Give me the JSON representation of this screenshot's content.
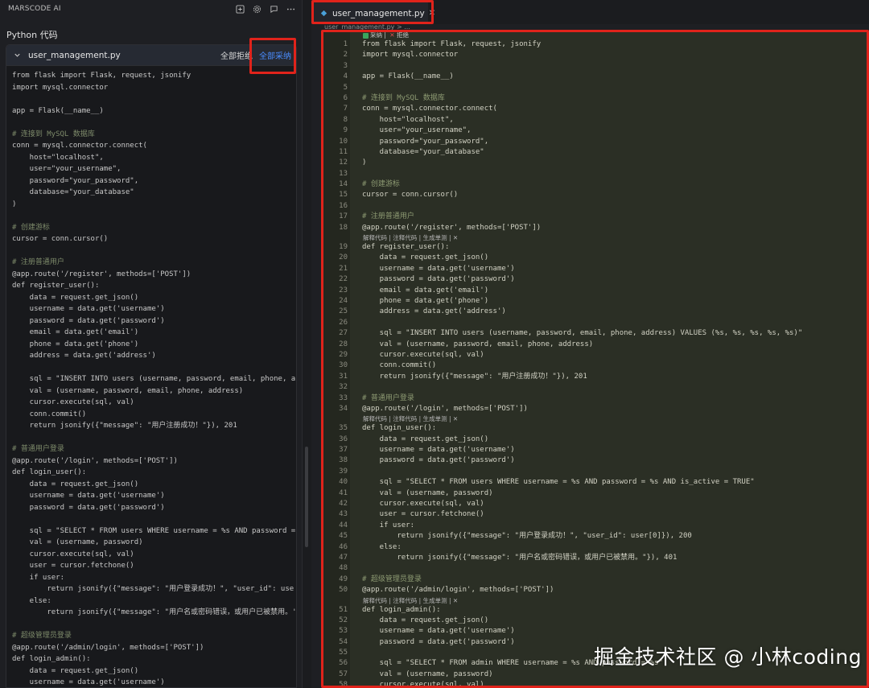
{
  "app_title": "MARSCODE AI",
  "section_title": "Python 代码",
  "card": {
    "filename": "user_management.py",
    "reject_all": "全部拒绝",
    "accept_all": "全部采纳"
  },
  "tab": {
    "filename": "user_management.py",
    "close": "✕"
  },
  "breadcrumb": "user_management.py > ...",
  "accept_bar": {
    "accept": "采纳",
    "reject": "拒绝"
  },
  "code_lens": "解释代码 | 注释代码 | 生成单测 | ✕",
  "left_code": [
    "from flask import Flask, request, jsonify",
    "import mysql.connector",
    "",
    "app = Flask(__name__)",
    "",
    "# 连接到 MySQL 数据库",
    "conn = mysql.connector.connect(",
    "    host=\"localhost\",",
    "    user=\"your_username\",",
    "    password=\"your_password\",",
    "    database=\"your_database\"",
    ")",
    "",
    "# 创建游标",
    "cursor = conn.cursor()",
    "",
    "# 注册普通用户",
    "@app.route('/register', methods=['POST'])",
    "def register_user():",
    "    data = request.get_json()",
    "    username = data.get('username')",
    "    password = data.get('password')",
    "    email = data.get('email')",
    "    phone = data.get('phone')",
    "    address = data.get('address')",
    "",
    "    sql = \"INSERT INTO users (username, password, email, phone, a",
    "    val = (username, password, email, phone, address)",
    "    cursor.execute(sql, val)",
    "    conn.commit()",
    "    return jsonify({\"message\": \"用户注册成功！\"}), 201",
    "",
    "# 普通用户登录",
    "@app.route('/login', methods=['POST'])",
    "def login_user():",
    "    data = request.get_json()",
    "    username = data.get('username')",
    "    password = data.get('password')",
    "",
    "    sql = \"SELECT * FROM users WHERE username = %s AND password =",
    "    val = (username, password)",
    "    cursor.execute(sql, val)",
    "    user = cursor.fetchone()",
    "    if user:",
    "        return jsonify({\"message\": \"用户登录成功！\", \"user_id\": use",
    "    else:",
    "        return jsonify({\"message\": \"用户名或密码错误，或用户已被禁用。'",
    "",
    "# 超级管理员登录",
    "@app.route('/admin/login', methods=['POST'])",
    "def login_admin():",
    "    data = request.get_json()",
    "    username = data.get('username')"
  ],
  "right_code": [
    {
      "n": "1",
      "t": "from flask import Flask, request, jsonify"
    },
    {
      "n": "2",
      "t": "import mysql.connector"
    },
    {
      "n": "3",
      "t": ""
    },
    {
      "n": "4",
      "t": "app = Flask(__name__)"
    },
    {
      "n": "5",
      "t": ""
    },
    {
      "n": "6",
      "t": "# 连接到 MySQL 数据库"
    },
    {
      "n": "7",
      "t": "conn = mysql.connector.connect("
    },
    {
      "n": "8",
      "t": "    host=\"localhost\","
    },
    {
      "n": "9",
      "t": "    user=\"your_username\","
    },
    {
      "n": "10",
      "t": "    password=\"your_password\","
    },
    {
      "n": "11",
      "t": "    database=\"your_database\""
    },
    {
      "n": "12",
      "t": ")"
    },
    {
      "n": "13",
      "t": ""
    },
    {
      "n": "14",
      "t": "# 创建游标"
    },
    {
      "n": "15",
      "t": "cursor = conn.cursor()"
    },
    {
      "n": "16",
      "t": ""
    },
    {
      "n": "17",
      "t": "# 注册普通用户"
    },
    {
      "n": "18",
      "t": "@app.route('/register', methods=['POST'])",
      "lens": true
    },
    {
      "n": "19",
      "t": "def register_user():"
    },
    {
      "n": "20",
      "t": "    data = request.get_json()"
    },
    {
      "n": "21",
      "t": "    username = data.get('username')"
    },
    {
      "n": "22",
      "t": "    password = data.get('password')"
    },
    {
      "n": "23",
      "t": "    email = data.get('email')"
    },
    {
      "n": "24",
      "t": "    phone = data.get('phone')"
    },
    {
      "n": "25",
      "t": "    address = data.get('address')"
    },
    {
      "n": "26",
      "t": ""
    },
    {
      "n": "27",
      "t": "    sql = \"INSERT INTO users (username, password, email, phone, address) VALUES (%s, %s, %s, %s, %s)\""
    },
    {
      "n": "28",
      "t": "    val = (username, password, email, phone, address)"
    },
    {
      "n": "29",
      "t": "    cursor.execute(sql, val)"
    },
    {
      "n": "30",
      "t": "    conn.commit()"
    },
    {
      "n": "31",
      "t": "    return jsonify({\"message\": \"用户注册成功！\"}), 201"
    },
    {
      "n": "32",
      "t": ""
    },
    {
      "n": "33",
      "t": "# 普通用户登录"
    },
    {
      "n": "34",
      "t": "@app.route('/login', methods=['POST'])",
      "lens": true
    },
    {
      "n": "35",
      "t": "def login_user():"
    },
    {
      "n": "36",
      "t": "    data = request.get_json()"
    },
    {
      "n": "37",
      "t": "    username = data.get('username')"
    },
    {
      "n": "38",
      "t": "    password = data.get('password')"
    },
    {
      "n": "39",
      "t": ""
    },
    {
      "n": "40",
      "t": "    sql = \"SELECT * FROM users WHERE username = %s AND password = %s AND is_active = TRUE\""
    },
    {
      "n": "41",
      "t": "    val = (username, password)"
    },
    {
      "n": "42",
      "t": "    cursor.execute(sql, val)"
    },
    {
      "n": "43",
      "t": "    user = cursor.fetchone()"
    },
    {
      "n": "44",
      "t": "    if user:"
    },
    {
      "n": "45",
      "t": "        return jsonify({\"message\": \"用户登录成功！\", \"user_id\": user[0]}), 200"
    },
    {
      "n": "46",
      "t": "    else:"
    },
    {
      "n": "47",
      "t": "        return jsonify({\"message\": \"用户名或密码错误，或用户已被禁用。\"}), 401"
    },
    {
      "n": "48",
      "t": ""
    },
    {
      "n": "49",
      "t": "# 超级管理员登录"
    },
    {
      "n": "50",
      "t": "@app.route('/admin/login', methods=['POST'])",
      "lens": true
    },
    {
      "n": "51",
      "t": "def login_admin():"
    },
    {
      "n": "52",
      "t": "    data = request.get_json()"
    },
    {
      "n": "53",
      "t": "    username = data.get('username')"
    },
    {
      "n": "54",
      "t": "    password = data.get('password')"
    },
    {
      "n": "55",
      "t": ""
    },
    {
      "n": "56",
      "t": "    sql = \"SELECT * FROM admin WHERE username = %s AND password = %s\""
    },
    {
      "n": "57",
      "t": "    val = (username, password)"
    },
    {
      "n": "58",
      "t": "    cursor.execute(sql, val)"
    }
  ],
  "watermark": "掘金技术社区 @ 小林coding",
  "colors": {
    "accent": "#4a8dff",
    "highlight_box": "#e0231b",
    "diff_bg": "#2b2f25"
  }
}
